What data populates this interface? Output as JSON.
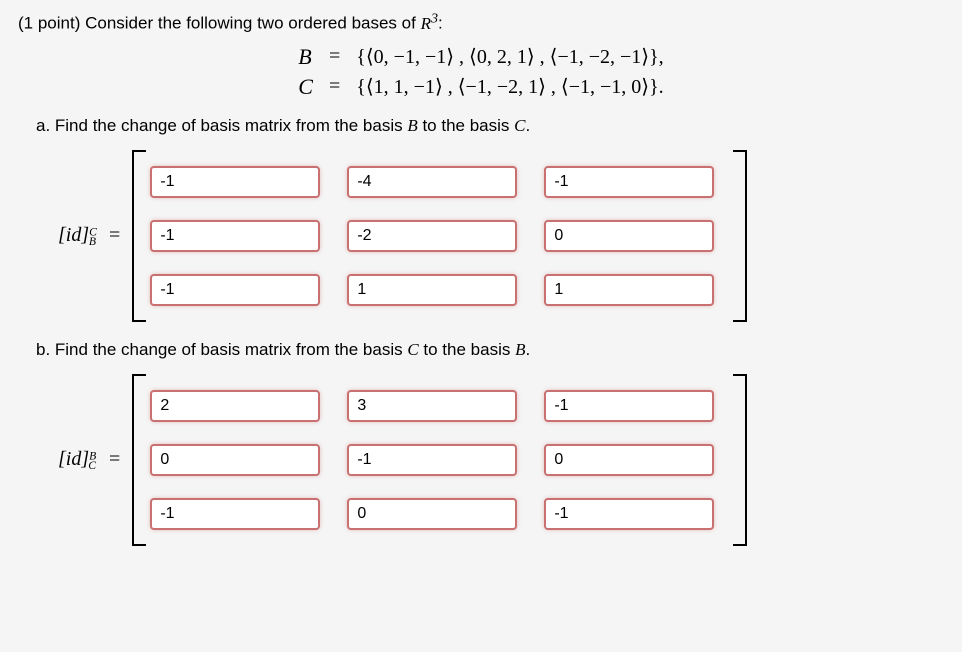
{
  "intro": "(1 point) Consider the following two ordered bases of ",
  "space": "R",
  "space_sup": "3",
  "bases": {
    "B_label": "B",
    "C_label": "C",
    "eq": "=",
    "B_set": "{⟨0, −1, −1⟩ , ⟨0, 2, 1⟩ , ⟨−1, −2, −1⟩},",
    "C_set": "{⟨1, 1, −1⟩ , ⟨−1, −2, 1⟩ , ⟨−1, −1, 0⟩}."
  },
  "part_a": {
    "text": "a. Find the change of basis matrix from the basis ",
    "from": "B",
    "mid": " to the basis ",
    "to": "C",
    "end": ".",
    "label_id": "[id]",
    "sup": "C",
    "sub": "B",
    "eq": " =",
    "matrix": [
      [
        "-1",
        "-4",
        "-1"
      ],
      [
        "-1",
        "-2",
        "0"
      ],
      [
        "-1",
        "1",
        "1"
      ]
    ]
  },
  "part_b": {
    "text": "b. Find the change of basis matrix from the basis ",
    "from": "C",
    "mid": " to the basis ",
    "to": "B",
    "end": ".",
    "label_id": "[id]",
    "sup": "B",
    "sub": "C",
    "eq": " =",
    "matrix": [
      [
        "2",
        "3",
        "-1"
      ],
      [
        "0",
        "-1",
        "0"
      ],
      [
        "-1",
        "0",
        "-1"
      ]
    ]
  }
}
